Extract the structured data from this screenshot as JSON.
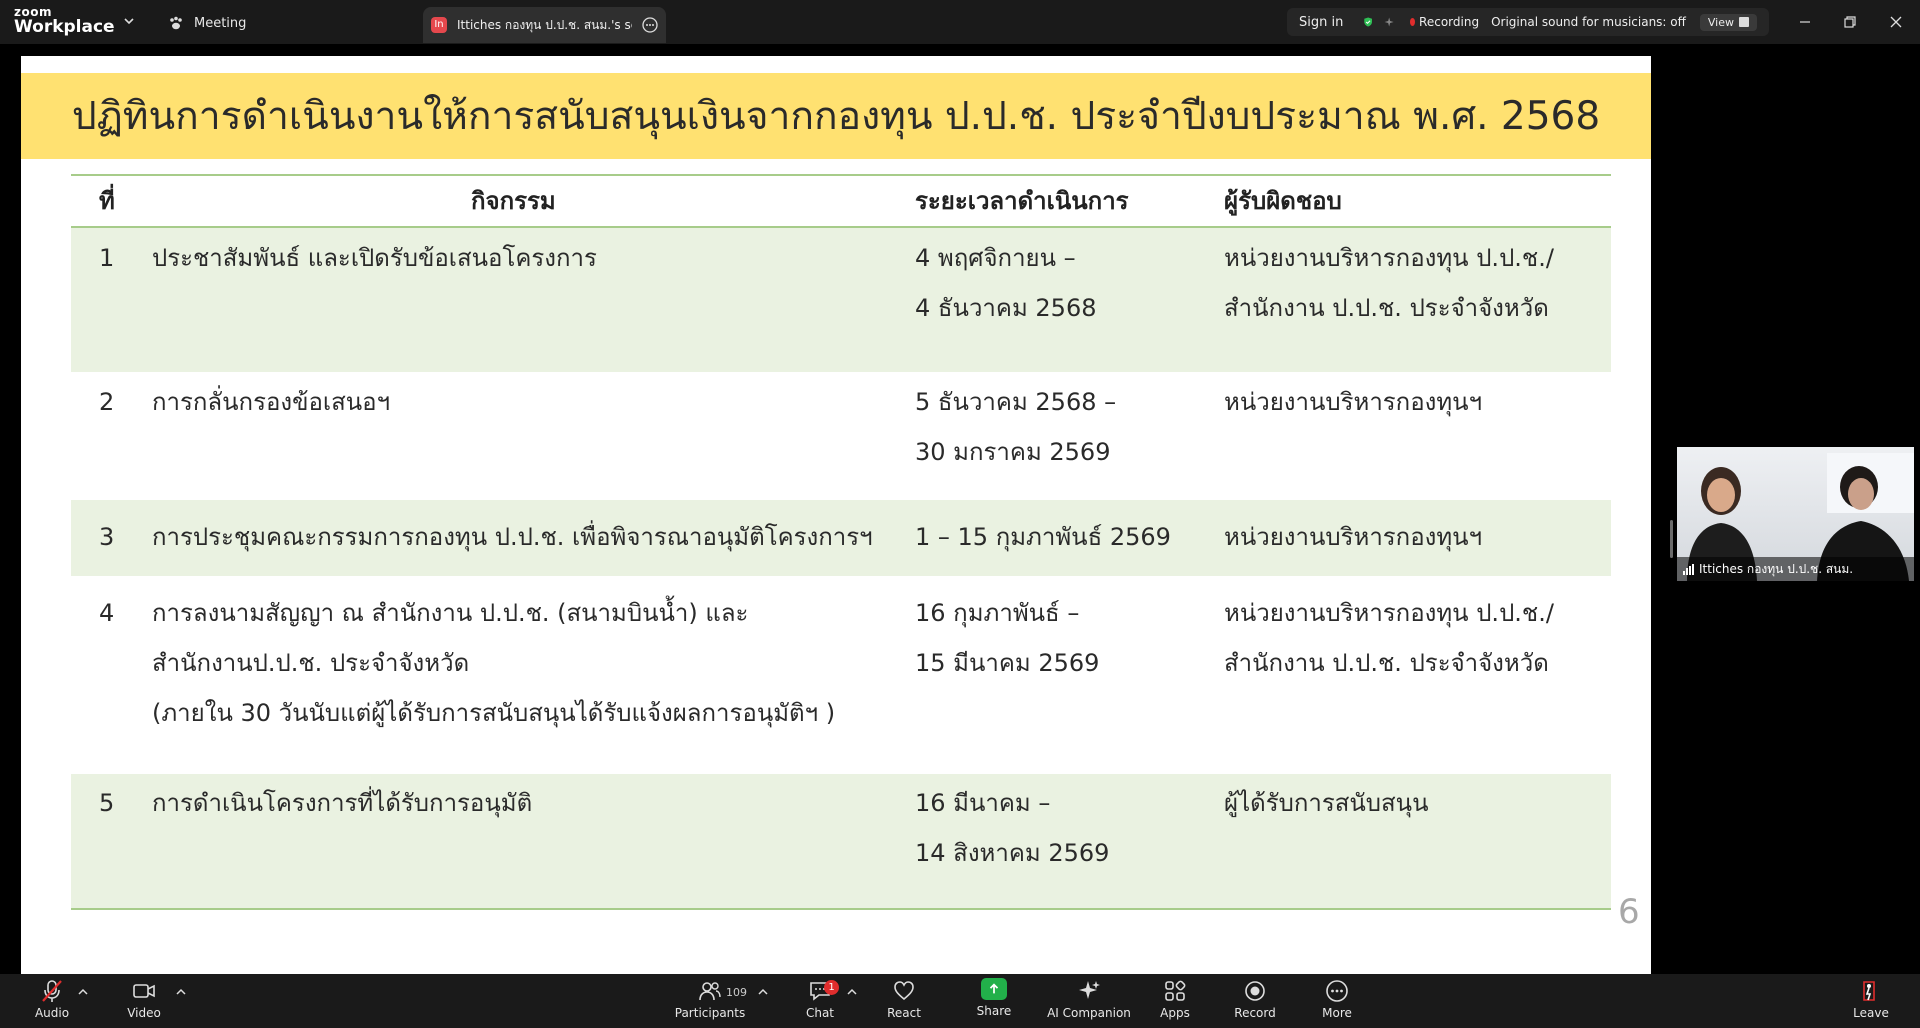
{
  "topbar": {
    "logo_line1": "zoom",
    "logo_line2": "Workplace",
    "meeting_tab": "Meeting",
    "share_tab_badge": "In",
    "share_tab": "Ittiches กองทุน ป.ป.ช. สนม.'s screen",
    "sign_in": "Sign in",
    "recording": "Recording",
    "original_sound": "Original sound for musicians: off",
    "view": "View"
  },
  "slide": {
    "title": "ปฏิทินการดำเนินงานให้การสนับสนุนเงินจากกองทุน ป.ป.ช. ประจำปีงบประมาณ พ.ศ. 2568",
    "headers": {
      "no": "ที่",
      "activity": "กิจกรรม",
      "period": "ระยะเวลาดำเนินการ",
      "responsible": "ผู้รับผิดชอบ"
    },
    "rows": [
      {
        "no": "1",
        "activity": [
          "ประชาสัมพันธ์ และเปิดรับข้อเสนอโครงการ"
        ],
        "period": [
          "4 พฤศจิกายน –",
          "4 ธันวาคม 2568"
        ],
        "responsible": [
          "หน่วยงานบริหารกองทุน ป.ป.ช./",
          "สำนักงาน ป.ป.ช. ประจำจังหวัด"
        ]
      },
      {
        "no": "2",
        "activity": [
          "การกลั่นกรองข้อเสนอฯ"
        ],
        "period": [
          "5 ธันวาคม 2568 –",
          "30 มกราคม 2569"
        ],
        "responsible": [
          "หน่วยงานบริหารกองทุนฯ"
        ]
      },
      {
        "no": "3",
        "activity": [
          "การประชุมคณะกรรมการกองทุน ป.ป.ช. เพื่อพิจารณาอนุมัติโครงการฯ"
        ],
        "period": [
          "1 – 15 กุมภาพันธ์ 2569"
        ],
        "responsible": [
          "หน่วยงานบริหารกองทุนฯ"
        ]
      },
      {
        "no": "4",
        "activity": [
          "การลงนามสัญญา ณ สำนักงาน ป.ป.ช. (สนามบินน้ำ) และ",
          "สำนักงานป.ป.ช. ประจำจังหวัด",
          "(ภายใน 30 วันนับแต่ผู้ได้รับการสนับสนุนได้รับแจ้งผลการอนุมัติฯ )"
        ],
        "period": [
          "16 กุมภาพันธ์ –",
          "15 มีนาคม 2569"
        ],
        "responsible": [
          "หน่วยงานบริหารกองทุน ป.ป.ช./",
          "สำนักงาน ป.ป.ช. ประจำจังหวัด"
        ]
      },
      {
        "no": "5",
        "activity": [
          "การดำเนินโครงการที่ได้รับการอนุมัติ"
        ],
        "period": [
          "16 มีนาคม –",
          "14 สิงหาคม 2569"
        ],
        "responsible": [
          "ผู้ได้รับการสนับสนุน"
        ]
      }
    ],
    "page_number": "6"
  },
  "video": {
    "participant_name": "Ittiches กองทุน ป.ป.ช. สนม."
  },
  "toolbar": {
    "audio": "Audio",
    "video": "Video",
    "participants": "Participants",
    "participants_count": "109",
    "chat": "Chat",
    "chat_badge": "1",
    "react": "React",
    "share": "Share",
    "ai_companion": "AI Companion",
    "apps": "Apps",
    "record": "Record",
    "more": "More",
    "leave": "Leave"
  },
  "colors": {
    "title_band": "#ffe171",
    "row_shade": "#eaf2e1",
    "rule": "#a7cc8a",
    "share_green": "#22b04a",
    "recording_red": "#e02d2d"
  },
  "icons": [
    "chevron-down-icon",
    "paw-icon",
    "more-circle-icon",
    "shield-check-icon",
    "sparkle-icon",
    "minimize-icon",
    "restore-icon",
    "close-icon",
    "mic-muted-icon",
    "camera-icon",
    "participants-icon",
    "chat-icon",
    "heart-icon",
    "share-arrow-icon",
    "ai-sparkle-icon",
    "apps-icon",
    "record-icon",
    "more-icon",
    "leave-icon"
  ]
}
